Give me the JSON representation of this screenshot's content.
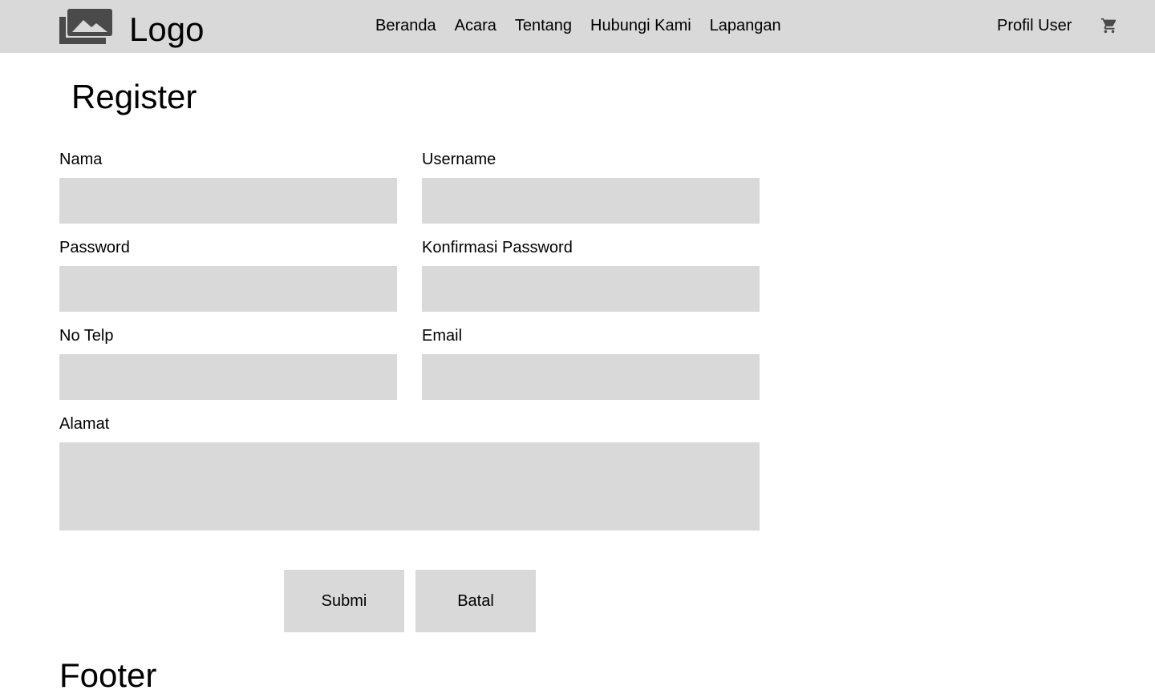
{
  "header": {
    "logo_text": "Logo",
    "logo_icon": "image-icon",
    "nav": [
      {
        "label": "Beranda"
      },
      {
        "label": "Acara"
      },
      {
        "label": "Tentang"
      },
      {
        "label": "Hubungi Kami"
      },
      {
        "label": "Lapangan"
      }
    ],
    "profile_label": "Profil User",
    "cart_icon": "shopping-cart-icon"
  },
  "page": {
    "title": "Register"
  },
  "form": {
    "nama": {
      "label": "Nama",
      "value": ""
    },
    "username": {
      "label": "Username",
      "value": ""
    },
    "password": {
      "label": "Password",
      "value": ""
    },
    "confirm_password": {
      "label": "Konfirmasi Password",
      "value": ""
    },
    "no_telp": {
      "label": "No Telp",
      "value": ""
    },
    "email": {
      "label": "Email",
      "value": ""
    },
    "alamat": {
      "label": "Alamat",
      "value": ""
    },
    "submit_label": "Submi",
    "cancel_label": "Batal"
  },
  "footer": {
    "title": "Footer"
  },
  "colors": {
    "header_bg": "#d9d9d9",
    "field_bg": "#d9d9d9",
    "icon": "#4a4a4a"
  }
}
